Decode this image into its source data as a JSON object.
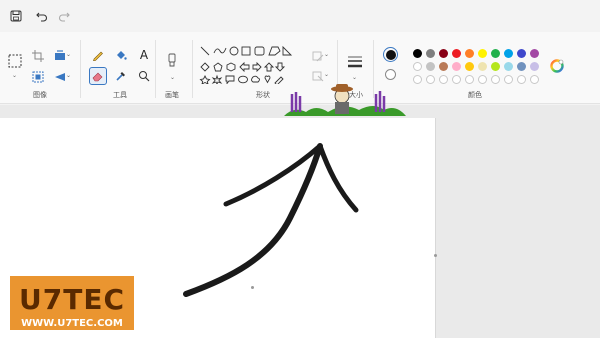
{
  "ribbon": {
    "groups": {
      "image": "图像",
      "tools": "工具",
      "brushes": "画笔",
      "shapes": "形状",
      "size": "大小",
      "colors": "颜色"
    }
  },
  "colors": {
    "selected_primary": "#111111",
    "selected_secondary": "#ffffff",
    "palette_row1": [
      "#000000",
      "#7f7f7f",
      "#880015",
      "#ed1c24",
      "#ff7f27",
      "#fff200",
      "#22b14c",
      "#00a2e8",
      "#3f48cc",
      "#a349a4"
    ],
    "palette_row2": [
      "#ffffff",
      "#c3c3c3",
      "#b97a57",
      "#ffaec9",
      "#ffc90e",
      "#efe4b0",
      "#b5e61d",
      "#99d9ea",
      "#7092be",
      "#c8bfe7"
    ],
    "accent": "#0067c0"
  },
  "watermark": {
    "brand": "U7TEC",
    "url": "WWW.U7TEC.COM"
  },
  "icons": [
    "save-icon",
    "undo-icon",
    "redo-icon",
    "select-icon",
    "crop-icon",
    "resize-icon",
    "rotate-icon",
    "pencil-icon",
    "fill-icon",
    "text-icon",
    "eraser-icon",
    "color-picker-icon",
    "magnifier-icon",
    "brush-icon",
    "outline-icon",
    "fill-style-icon",
    "size-icon",
    "edit-colors-icon"
  ]
}
